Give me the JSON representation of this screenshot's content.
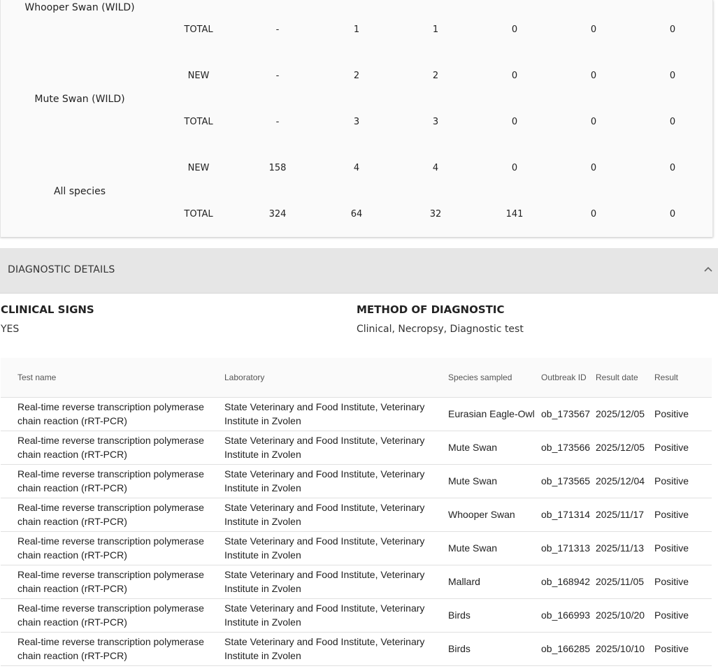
{
  "summary": {
    "species": [
      {
        "name": "Whooper Swan (WILD)",
        "rows": [
          {
            "type": "TOTAL",
            "values": [
              "-",
              "1",
              "1",
              "0",
              "0",
              "0"
            ]
          }
        ]
      },
      {
        "name": "Mute Swan (WILD)",
        "rows": [
          {
            "type": "NEW",
            "values": [
              "-",
              "2",
              "2",
              "0",
              "0",
              "0"
            ]
          },
          {
            "type": "TOTAL",
            "values": [
              "-",
              "3",
              "3",
              "0",
              "0",
              "0"
            ]
          }
        ]
      },
      {
        "name": "All species",
        "rows": [
          {
            "type": "NEW",
            "values": [
              "158",
              "4",
              "4",
              "0",
              "0",
              "0"
            ]
          },
          {
            "type": "TOTAL",
            "values": [
              "324",
              "64",
              "32",
              "141",
              "0",
              "0"
            ]
          }
        ]
      }
    ]
  },
  "diagnostic": {
    "section_title": "DIAGNOSTIC DETAILS",
    "clinical_signs_label": "CLINICAL SIGNS",
    "clinical_signs_value": "YES",
    "method_label": "METHOD OF DIAGNOSTIC",
    "method_value": "Clinical, Necropsy, Diagnostic test"
  },
  "tests": {
    "headers": [
      "Test name",
      "Laboratory",
      "Species sampled",
      "Outbreak ID",
      "Result date",
      "Result"
    ],
    "rows": [
      {
        "test_line1": "Real-time reverse transcription polymerase",
        "test_line2": "chain reaction (rRT-PCR)",
        "lab_line1": "State Veterinary and Food Institute, Veterinary",
        "lab_line2": "Institute in Zvolen",
        "species": "Eurasian Eagle-Owl",
        "outbreak": "ob_173567",
        "date": "2025/12/05",
        "result": "Positive"
      },
      {
        "test_line1": "Real-time reverse transcription polymerase",
        "test_line2": "chain reaction (rRT-PCR)",
        "lab_line1": "State Veterinary and Food Institute, Veterinary",
        "lab_line2": "Institute in Zvolen",
        "species": "Mute Swan",
        "outbreak": "ob_173566",
        "date": "2025/12/05",
        "result": "Positive"
      },
      {
        "test_line1": "Real-time reverse transcription polymerase",
        "test_line2": "chain reaction (rRT-PCR)",
        "lab_line1": "State Veterinary and Food Institute, Veterinary",
        "lab_line2": "Institute in Zvolen",
        "species": "Mute Swan",
        "outbreak": "ob_173565",
        "date": "2025/12/04",
        "result": "Positive"
      },
      {
        "test_line1": "Real-time reverse transcription polymerase",
        "test_line2": "chain reaction (rRT-PCR)",
        "lab_line1": "State Veterinary and Food Institute, Veterinary",
        "lab_line2": "Institute in Zvolen",
        "species": "Whooper Swan",
        "outbreak": "ob_171314",
        "date": "2025/11/17",
        "result": "Positive"
      },
      {
        "test_line1": "Real-time reverse transcription polymerase",
        "test_line2": "chain reaction (rRT-PCR)",
        "lab_line1": "State Veterinary and Food Institute, Veterinary",
        "lab_line2": "Institute in Zvolen",
        "species": "Mute Swan",
        "outbreak": "ob_171313",
        "date": "2025/11/13",
        "result": "Positive"
      },
      {
        "test_line1": "Real-time reverse transcription polymerase",
        "test_line2": "chain reaction (rRT-PCR)",
        "lab_line1": "State Veterinary and Food Institute, Veterinary",
        "lab_line2": "Institute in Zvolen",
        "species": "Mallard",
        "outbreak": "ob_168942",
        "date": "2025/11/05",
        "result": "Positive"
      },
      {
        "test_line1": "Real-time reverse transcription polymerase",
        "test_line2": "chain reaction (rRT-PCR)",
        "lab_line1": "State Veterinary and Food Institute, Veterinary",
        "lab_line2": "Institute in Zvolen",
        "species": "Birds",
        "outbreak": "ob_166993",
        "date": "2025/10/20",
        "result": "Positive"
      },
      {
        "test_line1": "Real-time reverse transcription polymerase",
        "test_line2": "chain reaction (rRT-PCR)",
        "lab_line1": "State Veterinary and Food Institute, Veterinary",
        "lab_line2": "Institute in Zvolen",
        "species": "Birds",
        "outbreak": "ob_166285",
        "date": "2025/10/10",
        "result": "Positive"
      }
    ]
  }
}
